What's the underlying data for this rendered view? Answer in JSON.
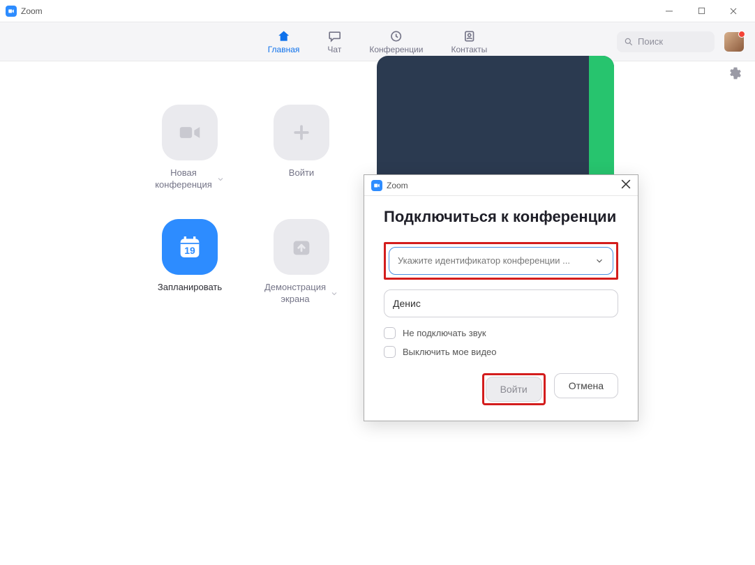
{
  "window": {
    "title": "Zoom"
  },
  "nav": {
    "items": [
      {
        "label": "Главная"
      },
      {
        "label": "Чат"
      },
      {
        "label": "Конференции"
      },
      {
        "label": "Контакты"
      }
    ],
    "search_placeholder": "Поиск"
  },
  "tiles": {
    "new_meeting": "Новая\nконференция",
    "join": "Войти",
    "schedule": "Запланировать",
    "schedule_day": "19",
    "share": "Демонстрация\nэкрана"
  },
  "dialog": {
    "title": "Zoom",
    "heading": "Подключиться к конференции",
    "meeting_id_placeholder": "Укажите идентификатор конференции ...",
    "name_value": "Денис",
    "chk_audio": "Не подключать звук",
    "chk_video": "Выключить мое видео",
    "btn_join": "Войти",
    "btn_cancel": "Отмена"
  }
}
